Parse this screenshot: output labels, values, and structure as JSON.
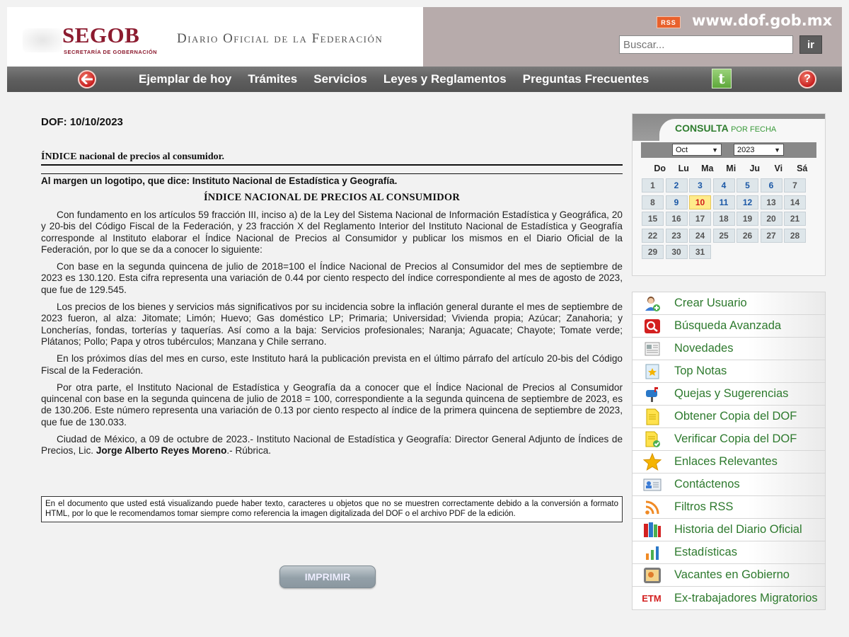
{
  "header": {
    "logo_text": "SEGOB",
    "logo_subtitle": "SECRETARÍA DE GOBERNACIÓN",
    "site_title": "Diario Oficial de la Federación",
    "rss_label": "RSS",
    "url": "www.dof.gob.mx",
    "search_placeholder": "Buscar...",
    "search_button": "ir"
  },
  "nav": {
    "items": [
      "Ejemplar de hoy",
      "Trámites",
      "Servicios",
      "Leyes y Reglamentos",
      "Preguntas Frecuentes"
    ],
    "twitter_glyph": "t",
    "help_glyph": "?"
  },
  "main": {
    "dof_date": "DOF: 10/10/2023",
    "doc_head": "ÍNDICE nacional de precios al consumidor.",
    "margin_note": "Al margen un logotipo, que dice: Instituto Nacional de Estadística y Geografía.",
    "doc_title": "ÍNDICE NACIONAL DE PRECIOS AL CONSUMIDOR",
    "paragraphs": [
      "Con fundamento en los artículos 59 fracción III, inciso a) de la Ley del Sistema Nacional de Información Estadística y Geográfica, 20 y 20-bis del Código Fiscal de la Federación, y 23 fracción X del Reglamento Interior del Instituto Nacional de Estadística y Geografía corresponde al Instituto elaborar el Índice Nacional de Precios al Consumidor y publicar los mismos en el Diario Oficial de la Federación, por lo que se da a conocer lo siguiente:",
      "Con base en la segunda quincena de julio de 2018=100 el Índice Nacional de Precios al Consumidor del mes de septiembre de 2023 es 130.120. Esta cifra representa una variación de 0.44 por ciento respecto del índice correspondiente al mes de agosto de 2023, que fue de 129.545.",
      "Los precios de los bienes y servicios más significativos por su incidencia sobre la inflación general durante el mes de septiembre de 2023 fueron, al alza: Jitomate; Limón; Huevo; Gas doméstico LP; Primaria; Universidad; Vivienda propia; Azúcar; Zanahoria; y Loncherías, fondas, torterías y taquerías. Así como a la baja: Servicios profesionales; Naranja; Aguacate; Chayote; Tomate verde; Plátanos; Pollo; Papa y otros tubérculos; Manzana y Chile serrano.",
      "En los próximos días del mes en curso, este Instituto hará la publicación prevista en el último párrafo del artículo 20-bis del Código Fiscal de la Federación.",
      "Por otra parte, el Instituto Nacional de Estadística y Geografía da a conocer que el Índice Nacional de Precios al Consumidor quincenal con base en la segunda quincena de julio de 2018 = 100, correspondiente a la segunda quincena de septiembre de 2023, es de 130.206. Este número representa una variación de 0.13 por ciento respecto al índice de la primera quincena de septiembre de 2023, que fue de 130.033."
    ],
    "closing_prefix": "Ciudad de México, a 09 de octubre de 2023.- Instituto Nacional de Estadística y Geografía: Director General Adjunto de Índices de Precios, Lic. ",
    "closing_name": "Jorge Alberto Reyes Moreno",
    "closing_suffix": ".- Rúbrica.",
    "disclaimer": "En el documento que usted está visualizando puede haber texto, caracteres u objetos que no se muestren correctamente debido a la conversión a formato HTML, por lo que le recomendamos tomar siempre como referencia la imagen digitalizada del DOF o el archivo PDF de la edición.",
    "print_button": "IMPRIMIR"
  },
  "calendar": {
    "title": "CONSULTA",
    "title_sub": "POR FECHA",
    "month": "Oct",
    "year": "2023",
    "weekdays": [
      "Do",
      "Lu",
      "Ma",
      "Mi",
      "Ju",
      "Vi",
      "Sá"
    ],
    "days": [
      "1",
      "2",
      "3",
      "4",
      "5",
      "6",
      "7",
      "8",
      "9",
      "10",
      "11",
      "12",
      "13",
      "14",
      "15",
      "16",
      "17",
      "18",
      "19",
      "20",
      "21",
      "22",
      "23",
      "24",
      "25",
      "26",
      "27",
      "28",
      "29",
      "30",
      "31"
    ],
    "today": "10",
    "colors": {
      "link": "#1b58a6",
      "today_bg": "#ffeb8a",
      "today_text": "#d21e1e",
      "title": "#2f7d2f"
    }
  },
  "sidebar": {
    "items": [
      {
        "label": "Crear Usuario",
        "icon": "user-add-icon"
      },
      {
        "label": "Búsqueda Avanzada",
        "icon": "search-icon"
      },
      {
        "label": "Novedades",
        "icon": "news-icon"
      },
      {
        "label": "Top Notas",
        "icon": "star-note-icon"
      },
      {
        "label": "Quejas y Sugerencias",
        "icon": "mailbox-icon"
      },
      {
        "label": "Obtener Copia del DOF",
        "icon": "document-icon"
      },
      {
        "label": "Verificar Copia del DOF",
        "icon": "document-check-icon"
      },
      {
        "label": "Enlaces Relevantes",
        "icon": "star-icon"
      },
      {
        "label": "Contáctenos",
        "icon": "contact-card-icon"
      },
      {
        "label": "Filtros RSS",
        "icon": "rss-icon"
      },
      {
        "label": "Historia del Diario Oficial",
        "icon": "books-icon"
      },
      {
        "label": "Estadísticas",
        "icon": "bar-chart-icon"
      },
      {
        "label": "Vacantes en Gobierno",
        "icon": "vacancy-icon"
      },
      {
        "label": "Ex-trabajadores Migratorios",
        "icon": "etm-icon",
        "icon_text": "ETM"
      }
    ],
    "colors": {
      "label": "#2e7a2e"
    }
  }
}
